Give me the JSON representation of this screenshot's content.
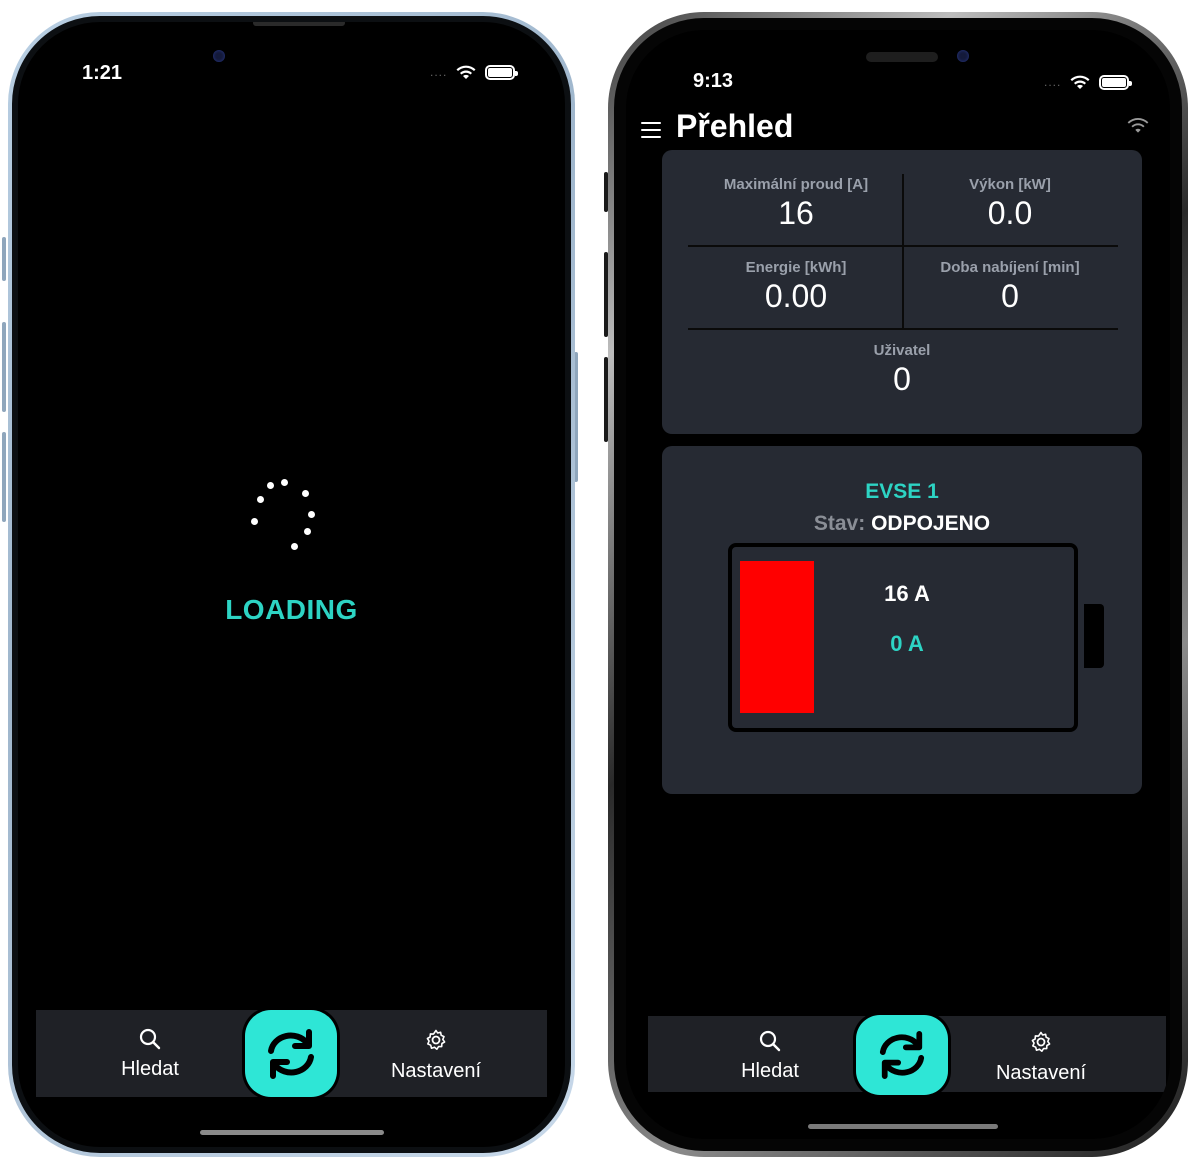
{
  "left_phone": {
    "status_bar": {
      "time": "1:21",
      "signal_dots": "....",
      "wifi_icon": "wifi-icon",
      "battery_icon": "battery-icon"
    },
    "loading": {
      "label": "LOADING",
      "color": "#2dd4c4"
    },
    "tabbar": {
      "search_label": "Hledat",
      "settings_label": "Nastavení",
      "refresh_icon": "refresh-icon"
    }
  },
  "right_phone": {
    "status_bar": {
      "time": "9:13",
      "signal_dots": "....",
      "wifi_icon": "wifi-icon",
      "battery_icon": "battery-icon"
    },
    "header": {
      "title": "Přehled",
      "menu_icon": "hamburger-icon",
      "connection_icon": "wifi-icon"
    },
    "metrics": {
      "max_current": {
        "label": "Maximální proud [A]",
        "value": "16"
      },
      "power": {
        "label": "Výkon [kW]",
        "value": "0.0"
      },
      "energy": {
        "label": "Energie [kWh]",
        "value": "0.00"
      },
      "charge_time": {
        "label": "Doba nabíjení [min]",
        "value": "0"
      },
      "user": {
        "label": "Uživatel",
        "value": "0"
      }
    },
    "evse": {
      "title": "EVSE 1",
      "state_label": "Stav:",
      "state_value": "ODPOJENO",
      "max_current": "16 A",
      "current": "0 A",
      "fill_color": "#ff0000"
    },
    "tabbar": {
      "search_label": "Hledat",
      "settings_label": "Nastavení",
      "refresh_icon": "refresh-icon"
    }
  },
  "colors": {
    "accent": "#2ee6d6",
    "accent_text": "#2dd4c4",
    "card_bg": "#262a33",
    "tabbar_bg": "#1f2126"
  }
}
